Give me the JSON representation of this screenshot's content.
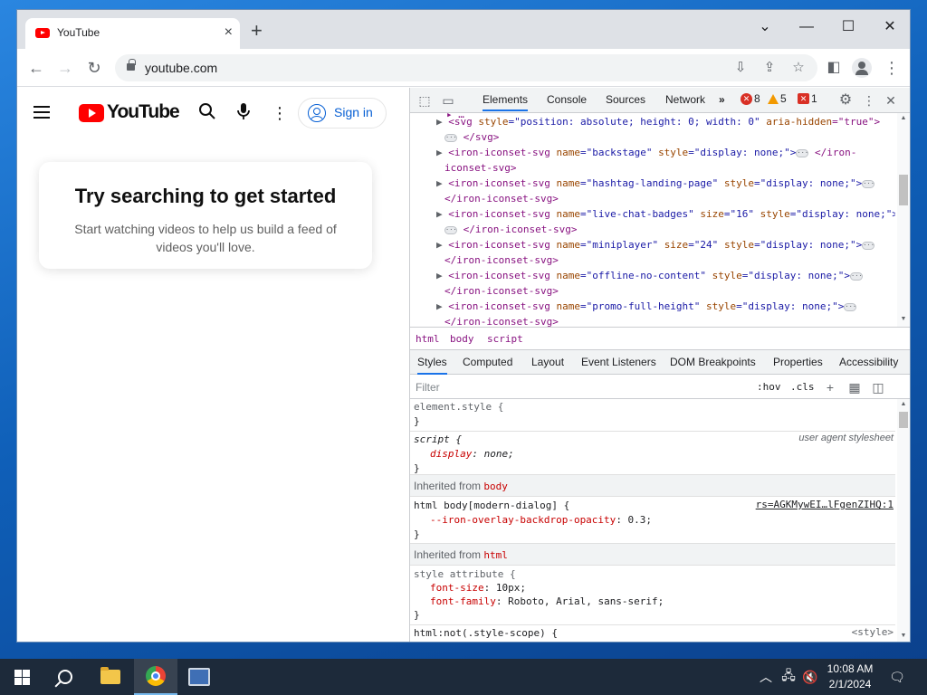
{
  "browser": {
    "tab_title": "YouTube",
    "url": "youtube.com"
  },
  "youtube": {
    "logo_text": "YouTube",
    "signin_label": "Sign in",
    "card_title": "Try searching to get started",
    "card_text": "Start watching videos to help us build a feed of videos you'll love.",
    "colors": {
      "brand_red": "#ff0000",
      "link_blue": "#065fd4"
    }
  },
  "devtools": {
    "tabs": [
      "Elements",
      "Console",
      "Sources",
      "Network"
    ],
    "error_count": "8",
    "warning_count": "5",
    "issue_count": "1",
    "dom_lines": {
      "l1a": "<svg ",
      "l1b": "style",
      "l1c": "=\"position: absolute; height: 0; width: 0\" ",
      "l1d": "aria-hidden",
      "l1e": "=\"true\">",
      "l2": "</svg>",
      "l3a": "<iron-iconset-svg ",
      "l3b": "name",
      "l3c": "=\"backstage\" ",
      "l3d": "style",
      "l3e": "=\"display: none;\">",
      "l3f": "</iron-",
      "l4": "iconset-svg>",
      "l5a": "<iron-iconset-svg ",
      "l5b": "name",
      "l5c": "=\"hashtag-landing-page\" ",
      "l5d": "style",
      "l5e": "=\"display: none;\">",
      "l6": "</iron-iconset-svg>",
      "l7a": "<iron-iconset-svg ",
      "l7b": "name",
      "l7c": "=\"live-chat-badges\" ",
      "l7d": "size",
      "l7e": "=\"16\" ",
      "l7f": "style",
      "l7g": "=\"display: none;\">",
      "l8": "</iron-iconset-svg>",
      "l9a": "<iron-iconset-svg ",
      "l9b": "name",
      "l9c": "=\"miniplayer\" ",
      "l9d": "size",
      "l9e": "=\"24\" ",
      "l9f": "style",
      "l9g": "=\"display: none;\">",
      "l10": "</iron-iconset-svg>",
      "l11a": "<iron-iconset-svg ",
      "l11b": "name",
      "l11c": "=\"offline-no-content\" ",
      "l11d": "style",
      "l11e": "=\"display: none;\">",
      "l12": "</iron-iconset-svg>",
      "l13a": "<iron-iconset-svg ",
      "l13b": "name",
      "l13c": "=\"promo-full-height\" ",
      "l13d": "style",
      "l13e": "=\"display: none;\">",
      "l14": "</iron-iconset-svg>"
    },
    "breadcrumbs": [
      "html",
      "body",
      "script"
    ],
    "sub_tabs": [
      "Styles",
      "Computed",
      "Layout",
      "Event Listeners",
      "DOM Breakpoints",
      "Properties",
      "Accessibility"
    ],
    "filter_placeholder": "Filter",
    "hov": ":hov",
    "cls": ".cls",
    "styles": {
      "r1_sel": "element.style {",
      "r1_close": "}",
      "r2_sel": "script {",
      "r2_src": "user agent stylesheet",
      "r2_prop": "display",
      "r2_val": ": none;",
      "r2_close": "}",
      "inh1_label": "Inherited from ",
      "inh1_tag": "body",
      "r3_sel": "html body[modern-dialog] {",
      "r3_src": "rs=AGKMywEI…lFgenZIHQ:1",
      "r3_prop": "--iron-overlay-backdrop-opacity",
      "r3_val": ": 0.3;",
      "r3_close": "}",
      "inh2_label": "Inherited from ",
      "inh2_tag": "html",
      "r4_sel": "style attribute {",
      "r4_p1": "font-size",
      "r4_v1": ": 10px;",
      "r4_p2": "font-family",
      "r4_v2": ": Roboto, Arial, sans-serif;",
      "r4_close": "}",
      "r5_sel": "html:not(.style-scope) {",
      "r5_src": "<style>"
    }
  },
  "taskbar": {
    "time": "10:08 AM",
    "date": "2/1/2024"
  }
}
